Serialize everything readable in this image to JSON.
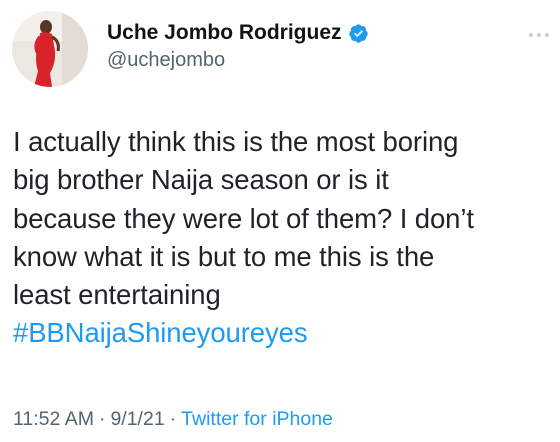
{
  "author": {
    "display_name": "Uche Jombo Rodriguez",
    "handle": "@uchejombo",
    "verified": true
  },
  "tweet": {
    "lines": [
      "I actually think this is the most boring",
      "big brother Naija season or is it",
      "because they were lot of them? I don’t",
      "know what it is but to me this is the",
      "least entertaining"
    ],
    "hashtag": "#BBNaijaShineyoureyes"
  },
  "meta": {
    "time": "11:52 AM",
    "separator": "·",
    "date": "9/1/21",
    "source": "Twitter for iPhone"
  },
  "colors": {
    "accent": "#1d9bf0",
    "text": "#0f1419",
    "muted": "#536471"
  },
  "icons": {
    "verified": "verified-badge-icon",
    "more": "more-options-icon"
  }
}
